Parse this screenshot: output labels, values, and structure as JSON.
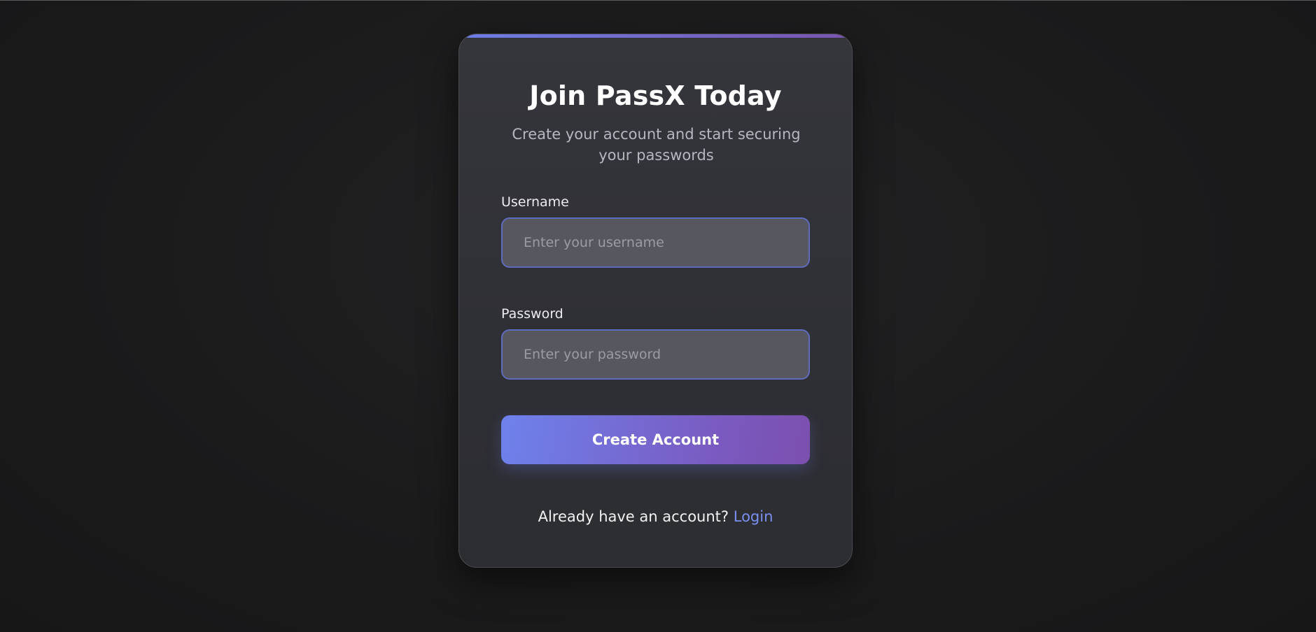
{
  "card": {
    "title": "Join PassX Today",
    "subtitle": "Create your account and start securing your passwords"
  },
  "form": {
    "username": {
      "label": "Username",
      "value": "",
      "placeholder": "Enter your username"
    },
    "password": {
      "label": "Password",
      "value": "",
      "placeholder": "Enter your password"
    },
    "submit_label": "Create Account"
  },
  "footer": {
    "prompt": "Already have an account?",
    "link_label": "Login"
  },
  "colors": {
    "accent_start": "#6e82ec",
    "accent_end": "#7b4fae",
    "link": "#7b8ff0",
    "background": "#1b1b1c",
    "card": "#323338"
  }
}
